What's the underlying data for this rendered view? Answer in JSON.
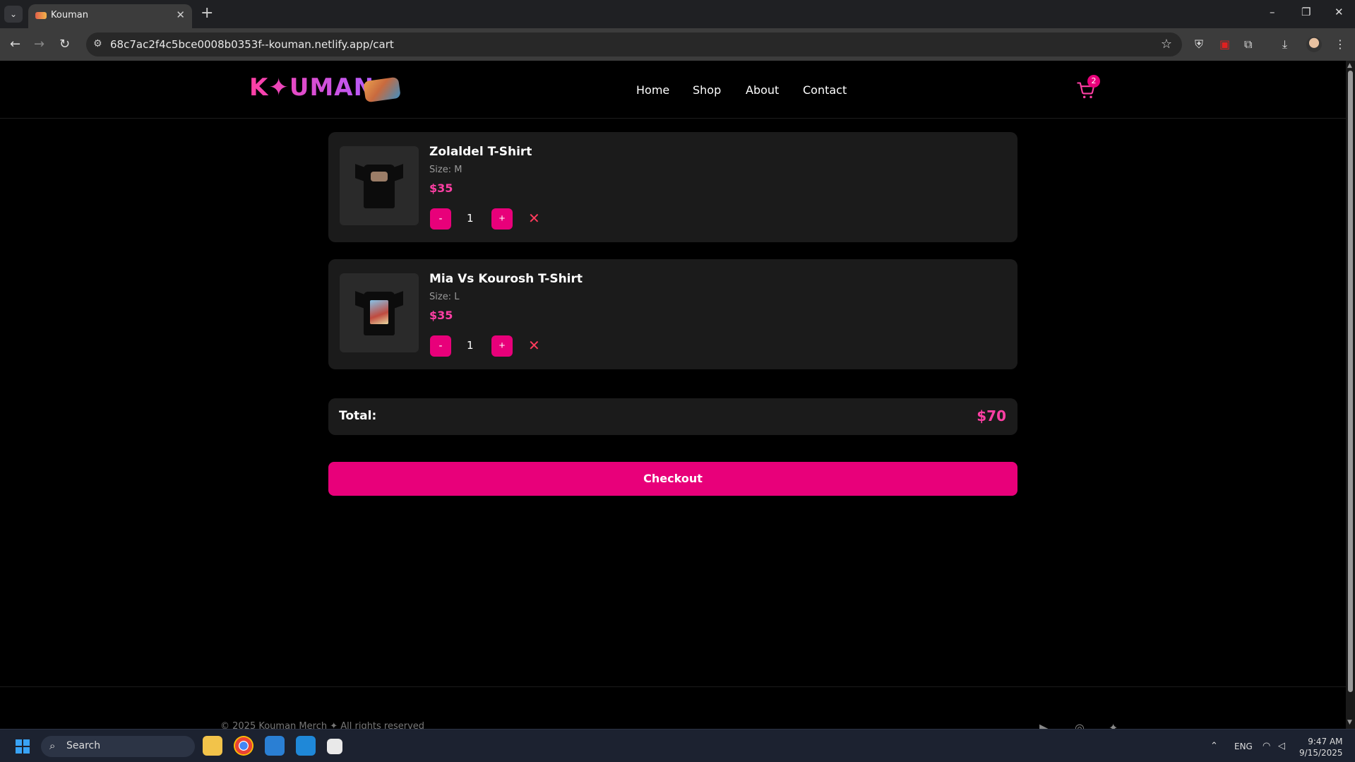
{
  "browser": {
    "tab_title": "Kouman",
    "url": "68c7ac2f4c5bce0008b0353f--kouman.netlify.app/cart"
  },
  "header": {
    "logo_text": "K✦UMAN",
    "nav": [
      "Home",
      "Shop",
      "About",
      "Contact"
    ],
    "cart_count": "2"
  },
  "cart": {
    "items": [
      {
        "name": "Zolaldel T-Shirt",
        "size": "Size: M",
        "price": "$35",
        "quantity": "1"
      },
      {
        "name": "Mia Vs Kourosh T-Shirt",
        "size": "Size: L",
        "price": "$35",
        "quantity": "1"
      }
    ],
    "decrement_label": "-",
    "increment_label": "+",
    "remove_label": "✕",
    "total_label": "Total:",
    "total_value": "$70",
    "checkout_label": "Checkout"
  },
  "footer": {
    "copyright": "© 2025 Kouman Merch ✦ All rights reserved"
  },
  "taskbar": {
    "search_placeholder": "Search",
    "language": "ENG",
    "time": "9:47 AM",
    "date": "9/15/2025"
  },
  "colors": {
    "accent": "#e8007a",
    "price": "#ff3fa4",
    "card_bg": "#1b1b1b",
    "remove": "#ff3b5c"
  },
  "icons": [
    "cart-icon",
    "star-icon",
    "remove-icon",
    "youtube-icon",
    "instagram-icon",
    "twitter-icon"
  ]
}
